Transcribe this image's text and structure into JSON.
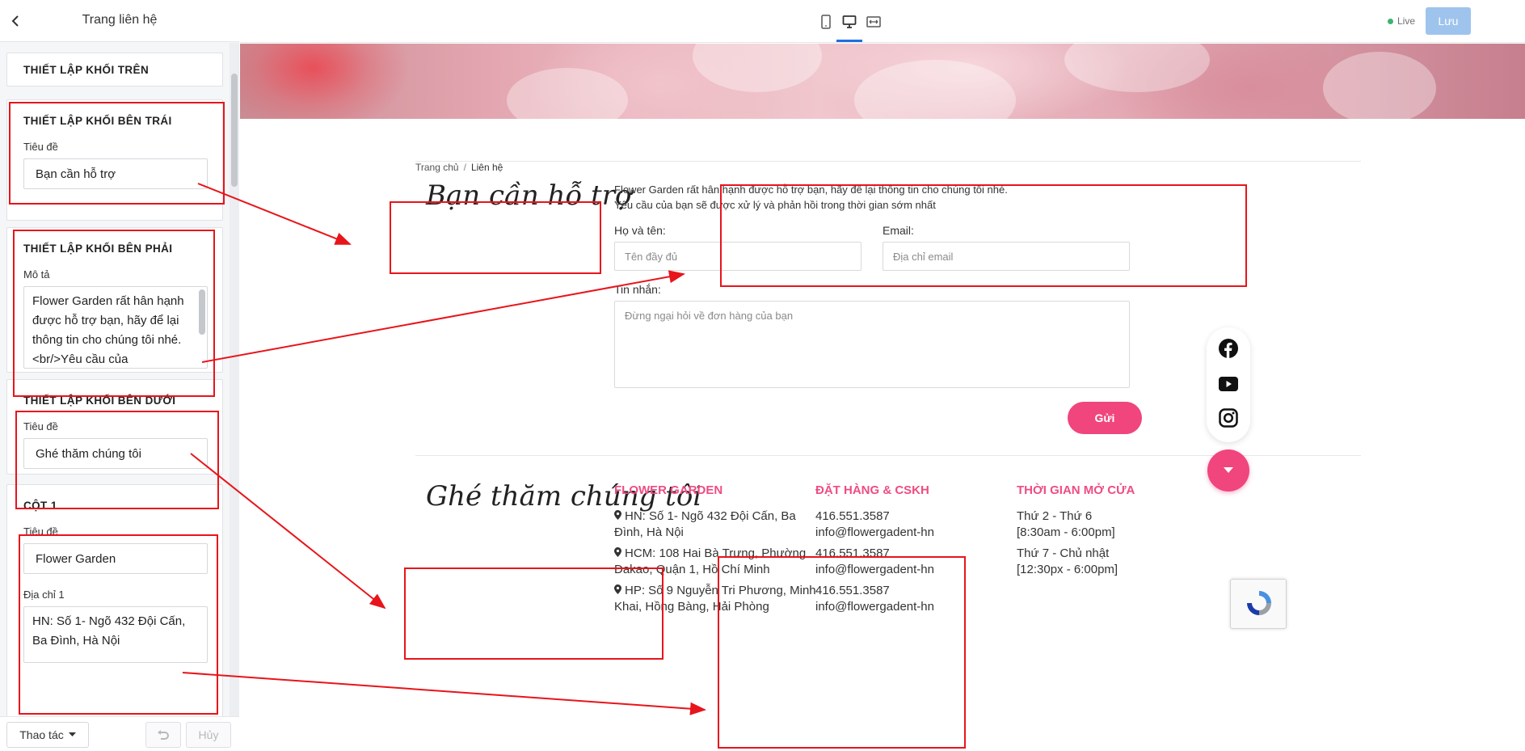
{
  "sidebar": {
    "title": "Trang liên hệ",
    "top_block": {
      "title": "THIẾT LẬP KHỐI TRÊN"
    },
    "left_block": {
      "title": "THIẾT LẬP KHỐI BÊN TRÁI",
      "label": "Tiêu đề",
      "value": "Bạn cần hỗ trợ"
    },
    "right_block": {
      "title": "THIẾT LẬP KHỐI BÊN PHẢI",
      "label": "Mô tả",
      "value": "Flower Garden rất hân hạnh được hỗ trợ bạn, hãy để lại thông tin cho chúng tôi nhé.<br/>Yêu cầu của"
    },
    "bottom_block": {
      "title": "THIẾT LẬP KHỐI BÊN DƯỚI",
      "label": "Tiêu đề",
      "value": "Ghé thăm chúng tôi"
    },
    "column1": {
      "title": "CỘT 1",
      "title_label": "Tiêu đề",
      "title_value": "Flower Garden",
      "address_label": "Địa chỉ 1",
      "address_value": "HN: Số 1- Ngõ 432 Đội Cấn, Ba Đình, Hà Nội"
    },
    "footer": {
      "actions_label": "Thao tác",
      "cancel_label": "Hủy"
    }
  },
  "topbar": {
    "live_label": "Live",
    "save_label": "Lưu"
  },
  "preview": {
    "breadcrumb": {
      "home": "Trang chủ",
      "separator": "/",
      "current": "Liên hệ"
    },
    "support_heading": "Bạn cần hỗ trợ",
    "intro_line1": "Flower Garden rất hân hạnh được hỗ trợ bạn, hãy để lại thông tin cho chúng tôi nhé.",
    "intro_line2": "Yêu cầu của bạn sẽ được xử lý và phản hồi trong thời gian sớm nhất",
    "form": {
      "name_label": "Họ và tên:",
      "name_placeholder": "Tên đầy đủ",
      "email_label": "Email:",
      "email_placeholder": "Địa chỉ email",
      "message_label": "Tin nhắn:",
      "message_placeholder": "Đừng ngại hỏi về đơn hàng của bạn",
      "send_label": "Gửi"
    },
    "visit_heading": "Ghé thăm chúng tôi",
    "columns": [
      {
        "title": "FLOWER GARDEN",
        "lines": [
          "HN: Số 1- Ngõ 432 Đội Cấn, Ba",
          "Đình, Hà Nội",
          "HCM: 108 Hai Bà Trưng, Phường",
          "Đakao, Quận 1, Hồ Chí Minh",
          "HP: Số 9 Nguyễn Tri Phương, Minh",
          "Khai, Hồng Bàng, Hải Phòng"
        ]
      },
      {
        "title": "ĐẶT HÀNG & CSKH",
        "lines": [
          "416.551.3587",
          "info@flowergadent-hn",
          "416.551.3587",
          "info@flowergadent-hn",
          "416.551.3587",
          "info@flowergadent-hn"
        ]
      },
      {
        "title": "THỜI GIAN MỞ CỬA",
        "lines": [
          "Thứ 2 - Thứ 6",
          "[8:30am - 6:00pm]",
          "Thứ 7 - Chủ nhật",
          "[12:30px - 6:00pm]"
        ]
      }
    ]
  },
  "colors": {
    "accent": "#ee4d80",
    "button_pink": "#f0457d",
    "annotation": "#e8141b",
    "save_disabled": "#9ec4ee",
    "active_device": "#1f6fe0"
  },
  "icons": [
    "chevron-left-icon",
    "tablet-icon",
    "desktop-icon",
    "fullwidth-icon",
    "caret-down-icon",
    "undo-icon",
    "map-pin-icon",
    "facebook-icon",
    "youtube-icon",
    "instagram-icon",
    "arrow-down-icon",
    "recaptcha-icon"
  ]
}
